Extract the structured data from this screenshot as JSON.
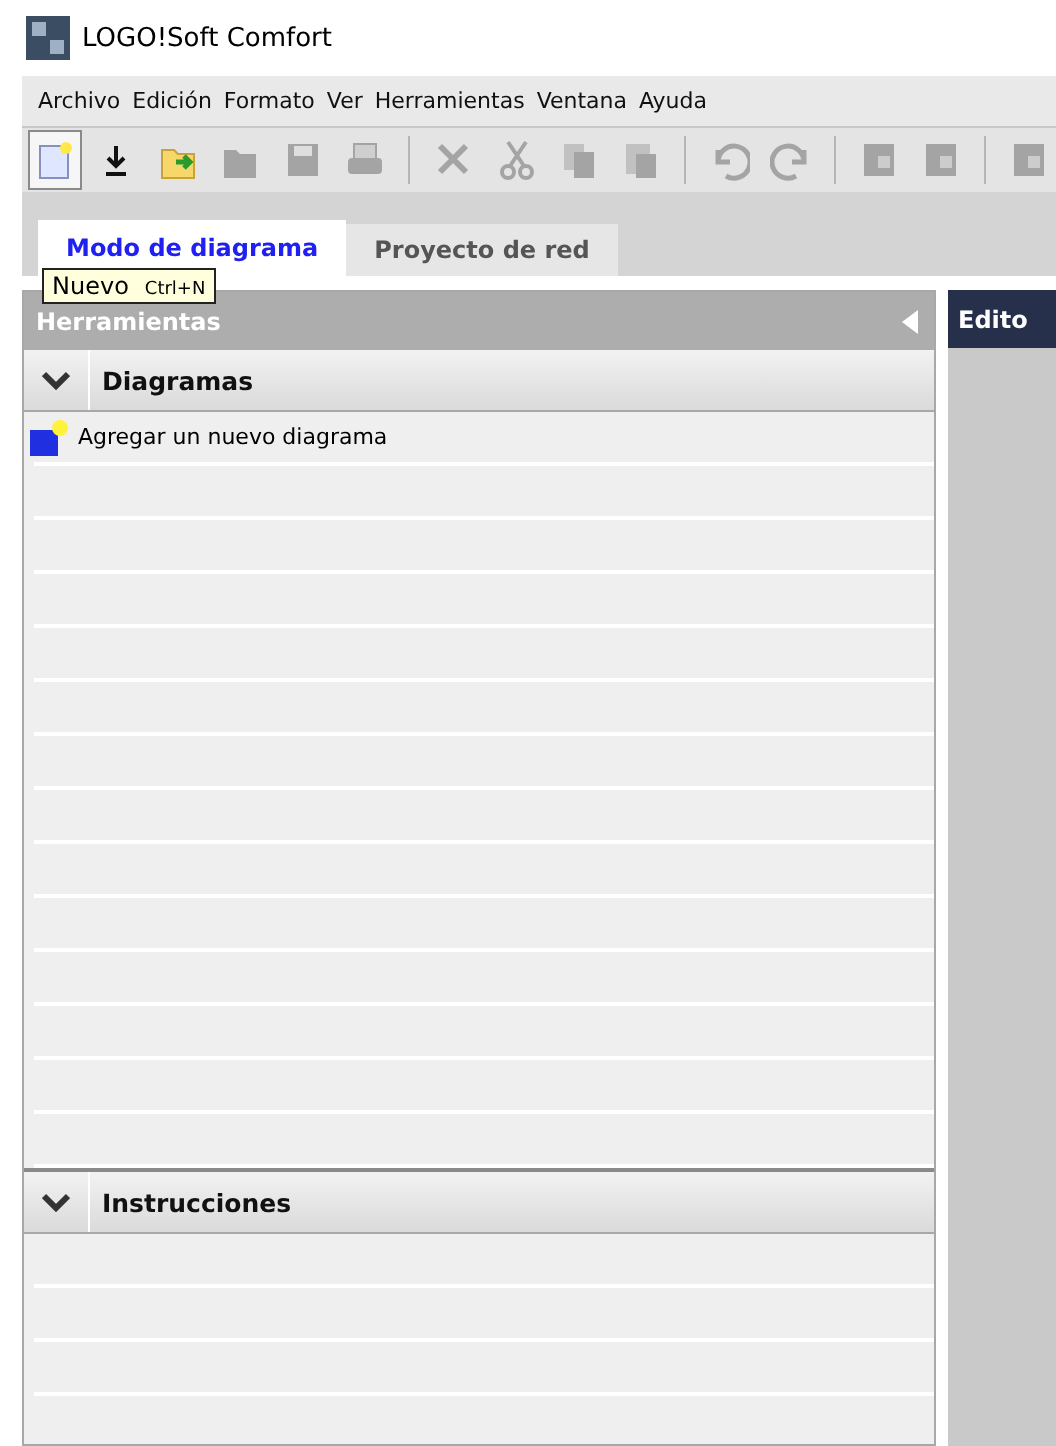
{
  "window": {
    "title": "LOGO!Soft Comfort"
  },
  "menu": [
    "Archivo",
    "Edición",
    "Formato",
    "Ver",
    "Herramientas",
    "Ventana",
    "Ayuda"
  ],
  "toolbar": [
    {
      "kind": "new",
      "disabled": false,
      "pressed": true
    },
    {
      "kind": "download",
      "disabled": false,
      "pressed": false
    },
    {
      "kind": "open",
      "disabled": false,
      "pressed": false
    },
    {
      "kind": "folder",
      "disabled": true,
      "pressed": false
    },
    {
      "kind": "save",
      "disabled": true,
      "pressed": false
    },
    {
      "kind": "print",
      "disabled": true,
      "pressed": false
    },
    {
      "kind": "separator"
    },
    {
      "kind": "delete",
      "disabled": true,
      "pressed": false
    },
    {
      "kind": "cut",
      "disabled": true,
      "pressed": false
    },
    {
      "kind": "copy",
      "disabled": true,
      "pressed": false
    },
    {
      "kind": "paste",
      "disabled": true,
      "pressed": false
    },
    {
      "kind": "separator"
    },
    {
      "kind": "undo",
      "disabled": true,
      "pressed": false
    },
    {
      "kind": "redo",
      "disabled": true,
      "pressed": false
    },
    {
      "kind": "separator"
    },
    {
      "kind": "block",
      "disabled": true,
      "pressed": false
    },
    {
      "kind": "block",
      "disabled": true,
      "pressed": false
    },
    {
      "kind": "separator"
    },
    {
      "kind": "block",
      "disabled": true,
      "pressed": false
    }
  ],
  "tooltip": {
    "label": "Nuevo",
    "shortcut": "Ctrl+N"
  },
  "tabs": [
    {
      "label": "Modo de diagrama",
      "selected": true
    },
    {
      "label": "Proyecto de red",
      "selected": false
    }
  ],
  "tools_panel": {
    "title": "Herramientas",
    "sections": [
      {
        "title": "Diagramas",
        "expanded": true,
        "items": [
          "Agregar un nuevo diagrama"
        ]
      },
      {
        "title": "Instrucciones",
        "expanded": true
      }
    ]
  },
  "editor": {
    "title": "Edito"
  }
}
